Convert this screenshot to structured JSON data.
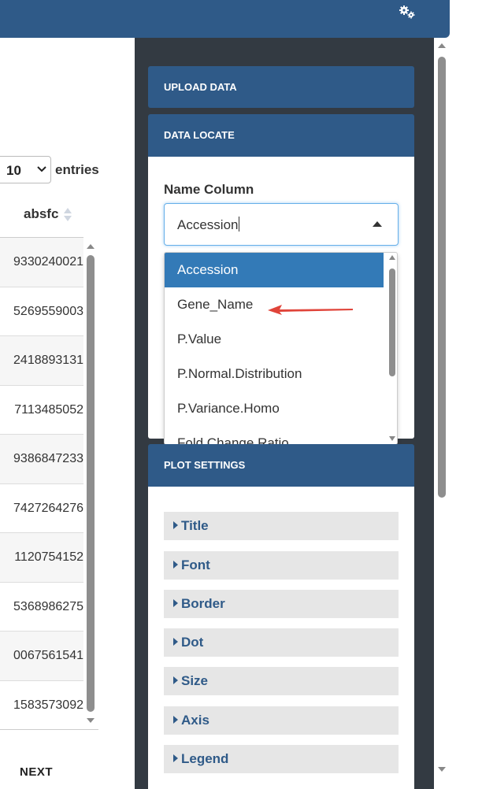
{
  "header": {
    "settings_icon": "gears-icon",
    "color": "#2f5a88"
  },
  "table": {
    "length_value": "10",
    "length_suffix": "entries",
    "column_header": "absfc",
    "values": [
      "9330240021",
      "5269559003",
      "2418893131",
      "7113485052",
      "9386847233",
      "7427264276",
      "1120754152",
      "5368986275",
      "0067561541",
      "1583573092"
    ],
    "next_label": "NEXT"
  },
  "sidebar": {
    "upload_title": "UPLOAD DATA",
    "locate_title": "DATA LOCATE",
    "name_column_label": "Name Column",
    "name_column_value": "Accession",
    "options": [
      "Accession",
      "Gene_Name",
      "P.Value",
      "P.Normal.Distribution",
      "P.Variance.Homo",
      "Fold.Change.Ratio"
    ],
    "selected_option": "Accession",
    "plot_title": "PLOT SETTINGS",
    "plot_items": [
      "Title",
      "Font",
      "Border",
      "Dot",
      "Size",
      "Axis",
      "Legend"
    ]
  },
  "colors": {
    "panel_header": "#2f5a88",
    "sidebar_bg": "#333a42",
    "selected_option": "#337ab7",
    "annotation_arrow": "#e0443a"
  }
}
